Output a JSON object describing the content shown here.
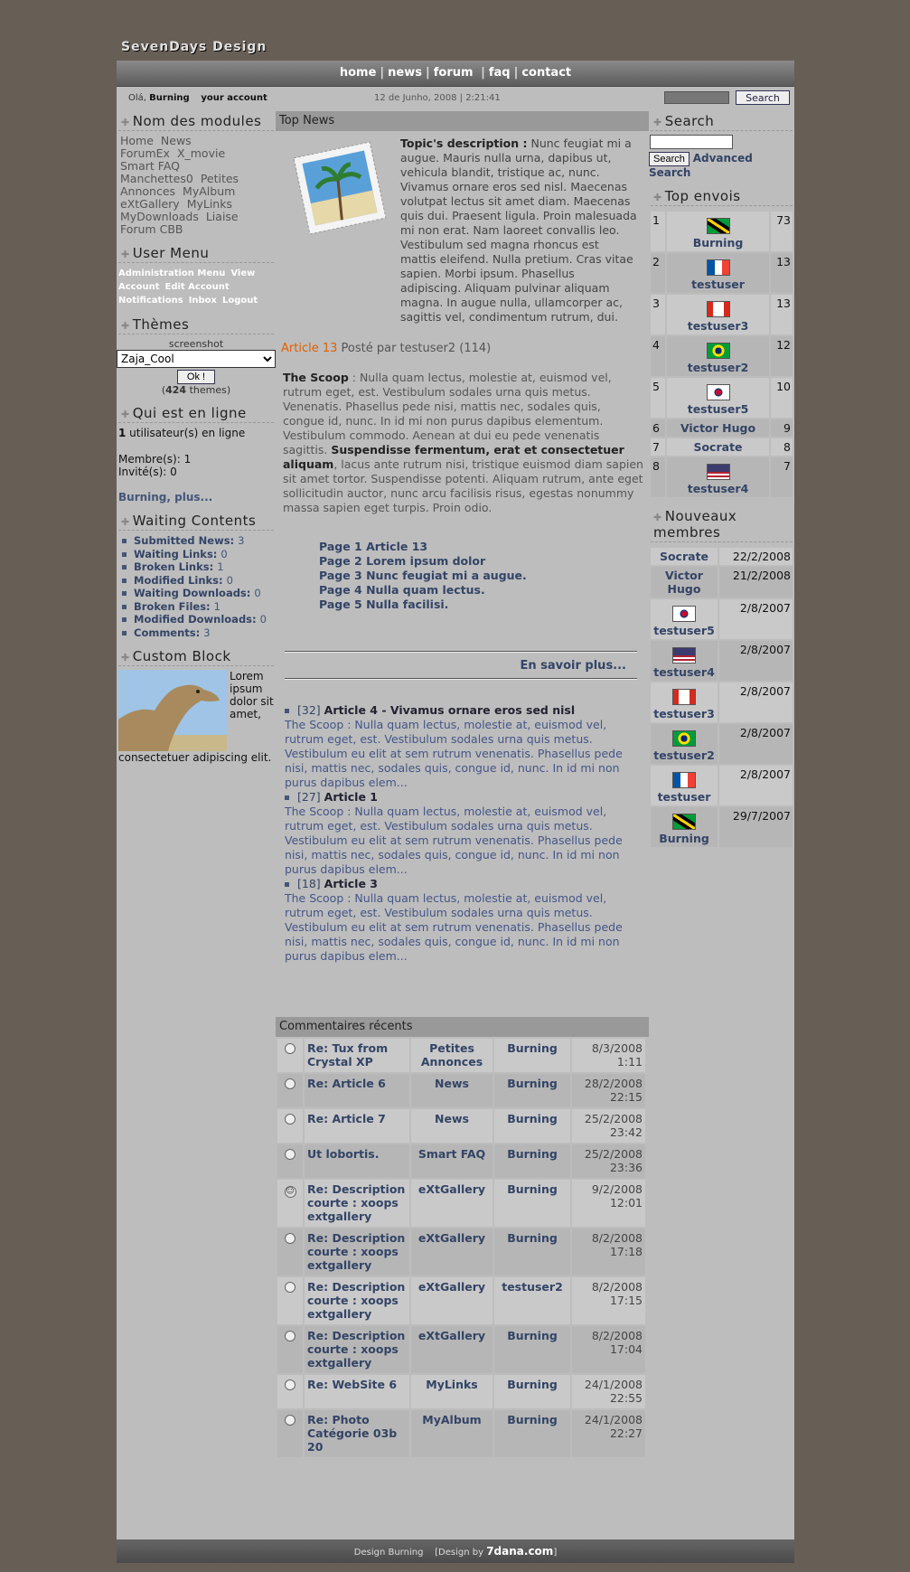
{
  "site": {
    "logo": "SevenDays Design"
  },
  "nav": {
    "items": [
      "home",
      "news",
      "forum",
      "faq",
      "contact"
    ]
  },
  "infobar": {
    "greeting_prefix": "Olá,",
    "username": "Burning",
    "account_link": "your account",
    "datetime": "12 de Junho, 2008 | 2:21:41",
    "search_button": "Search"
  },
  "left": {
    "modules": {
      "title": "Nom des modules",
      "items": [
        "Home",
        "News",
        "ForumEx",
        "X_movie",
        "Smart FAQ",
        "Manchettes0",
        "Petites Annonces",
        "MyAlbum",
        "eXtGallery",
        "MyLinks",
        "MyDownloads",
        "Liaise",
        "Forum CBB"
      ]
    },
    "usermenu": {
      "title": "User Menu",
      "items": [
        "Administration Menu",
        "View Account",
        "Edit Account",
        "Notifications",
        "Inbox",
        "Logout"
      ]
    },
    "themes": {
      "title": "Thèmes",
      "caption": "screenshot",
      "selected": "Zaja_Cool",
      "ok": "Ok !",
      "count_prefix": "(",
      "count": "424",
      "count_suffix": " themes)"
    },
    "online": {
      "title": "Qui est en ligne",
      "count": "1",
      "line1": " utilisateur(s) en ligne",
      "members": "Membre(s): 1",
      "guests": "Invité(s): 0",
      "more": "Burning, plus..."
    },
    "waiting": {
      "title": "Waiting Contents",
      "items": [
        {
          "label": "Submitted News:",
          "value": "3"
        },
        {
          "label": "Waiting Links:",
          "value": "0"
        },
        {
          "label": "Broken Links:",
          "value": "1"
        },
        {
          "label": "Modified Links:",
          "value": "0"
        },
        {
          "label": "Waiting Downloads:",
          "value": "0"
        },
        {
          "label": "Broken Files:",
          "value": "1"
        },
        {
          "label": "Modified Downloads:",
          "value": "0"
        },
        {
          "label": "Comments:",
          "value": "3"
        }
      ]
    },
    "custom": {
      "title": "Custom Block",
      "text": "Lorem ipsum dolor sit amet, consectetuer adipiscing elit."
    }
  },
  "center": {
    "top_news_title": "Top News",
    "desc_label": "Topic's description :",
    "desc_text": " Nunc feugiat mi a augue. Mauris nulla urna, dapibus ut, vehicula blandit, tristique ac, nunc. Vivamus ornare eros sed nisl. Maecenas volutpat lectus sit amet diam. Maecenas quis dui. Praesent ligula. Proin malesuada mi non erat. Nam laoreet convallis leo. Vestibulum sed magna rhoncus est mattis eleifend. Nulla pretium. Cras vitae sapien. Morbi ipsum. Phasellus adipiscing. Aliquam pulvinar aliquam magna. In augue nulla, ullamcorper ac, sagittis vel, condimentum rutrum, dui.",
    "article_title": "Article 13",
    "article_meta": " Posté par testuser2 (114)",
    "scoop_label": "The Scoop",
    "scoop_text1": " : Nulla quam lectus, molestie at, euismod vel, rutrum eget, est. Vestibulum sodales urna quis metus. Venenatis. Phasellus pede nisi, mattis nec, sodales quis, congue id, nunc. In id mi non purus dapibus elementum. Vestibulum commodo. Aenean at dui eu pede venenatis sagittis. ",
    "scoop_bold": "Suspendisse fermentum, erat et consectetuer aliquam",
    "scoop_text2": ", lacus ante rutrum nisi, tristique euismod diam sapien sit amet tortor. Suspendisse potenti. Aliquam rutrum, ante eget sollicitudin auctor, nunc arcu facilisis risus, egestas nonummy massa sapien eget turpis. Proin odio.",
    "pages": [
      "Page 1 Article 13",
      "Page 2 Lorem ipsum dolor",
      "Page 3 Nunc feugiat mi a augue.",
      "Page 4 Nulla quam lectus.",
      "Page 5 Nulla facilisi."
    ],
    "more": "En savoir plus...",
    "related": [
      {
        "id": "[32]",
        "title": "Article 4 - Vivamus ornare eros sed nisl",
        "body": "The Scoop : Nulla quam lectus, molestie at, euismod vel, rutrum eget, est. Vestibulum sodales urna quis metus. Vestibulum eu elit at sem rutrum venenatis. Phasellus pede nisi, mattis nec, sodales quis, congue id, nunc. In id mi non purus dapibus elem..."
      },
      {
        "id": "[27]",
        "title": "Article 1",
        "body": "The Scoop : Nulla quam lectus, molestie at, euismod vel, rutrum eget, est. Vestibulum sodales urna quis metus. Vestibulum eu elit at sem rutrum venenatis. Phasellus pede nisi, mattis nec, sodales quis, congue id, nunc. In id mi non purus dapibus elem..."
      },
      {
        "id": "[18]",
        "title": "Article 3",
        "body": "The Scoop : Nulla quam lectus, molestie at, euismod vel, rutrum eget, est. Vestibulum sodales urna quis metus. Vestibulum eu elit at sem rutrum venenatis. Phasellus pede nisi, mattis nec, sodales quis, congue id, nunc. In id mi non purus dapibus elem..."
      }
    ],
    "comments_title": "Commentaires récents",
    "comments": [
      {
        "icon": "radio",
        "title": "Re: Tux from Crystal XP",
        "module": "Petites Annonces",
        "user": "Burning",
        "date": "8/3/2008 1:11"
      },
      {
        "icon": "radio",
        "title": "Re: Article 6",
        "module": "News",
        "user": "Burning",
        "date": "28/2/2008 22:15"
      },
      {
        "icon": "radio",
        "title": "Re: Article 7",
        "module": "News",
        "user": "Burning",
        "date": "25/2/2008 23:42"
      },
      {
        "icon": "radio",
        "title": "Ut lobortis.",
        "module": "Smart FAQ",
        "user": "Burning",
        "date": "25/2/2008 23:36"
      },
      {
        "icon": "smiley",
        "title": "Re: Description courte : xoops extgallery",
        "module": "eXtGallery",
        "user": "Burning",
        "date": "9/2/2008 12:01"
      },
      {
        "icon": "radio",
        "title": "Re: Description courte : xoops extgallery",
        "module": "eXtGallery",
        "user": "Burning",
        "date": "8/2/2008 17:18"
      },
      {
        "icon": "radio",
        "title": "Re: Description courte : xoops extgallery",
        "module": "eXtGallery",
        "user": "testuser2",
        "date": "8/2/2008 17:15"
      },
      {
        "icon": "radio",
        "title": "Re: Description courte : xoops extgallery",
        "module": "eXtGallery",
        "user": "Burning",
        "date": "8/2/2008 17:04"
      },
      {
        "icon": "radio",
        "title": "Re: WebSite 6",
        "module": "MyLinks",
        "user": "Burning",
        "date": "24/1/2008 22:55"
      },
      {
        "icon": "radio",
        "title": "Re: Photo Catégorie 03b 20",
        "module": "MyAlbum",
        "user": "Burning",
        "date": "24/1/2008 22:27"
      }
    ]
  },
  "right": {
    "search": {
      "title": "Search",
      "button": "Search",
      "advanced": "Advanced Search"
    },
    "top": {
      "title": "Top envois",
      "rows": [
        {
          "rank": "1",
          "flag": "fl-jm",
          "user": "Burning",
          "count": "73"
        },
        {
          "rank": "2",
          "flag": "fl-fr",
          "user": "testuser",
          "count": "13"
        },
        {
          "rank": "3",
          "flag": "fl-ca",
          "user": "testuser3",
          "count": "13"
        },
        {
          "rank": "4",
          "flag": "fl-br",
          "user": "testuser2",
          "count": "12"
        },
        {
          "rank": "5",
          "flag": "fl-kr",
          "user": "testuser5",
          "count": "10"
        },
        {
          "rank": "6",
          "flag": "",
          "user": "Victor Hugo",
          "count": "9"
        },
        {
          "rank": "7",
          "flag": "",
          "user": "Socrate",
          "count": "8"
        },
        {
          "rank": "8",
          "flag": "fl-us",
          "user": "testuser4",
          "count": "7"
        }
      ]
    },
    "newmembers": {
      "title": "Nouveaux membres",
      "rows": [
        {
          "flag": "",
          "user": "Socrate",
          "date": "22/2/2008"
        },
        {
          "flag": "",
          "user": "Victor Hugo",
          "date": "21/2/2008"
        },
        {
          "flag": "fl-kr",
          "user": "testuser5",
          "date": "2/8/2007"
        },
        {
          "flag": "fl-us",
          "user": "testuser4",
          "date": "2/8/2007"
        },
        {
          "flag": "fl-ca",
          "user": "testuser3",
          "date": "2/8/2007"
        },
        {
          "flag": "fl-br",
          "user": "testuser2",
          "date": "2/8/2007"
        },
        {
          "flag": "fl-fr",
          "user": "testuser",
          "date": "2/8/2007"
        },
        {
          "flag": "fl-jm",
          "user": "Burning",
          "date": "29/7/2007"
        }
      ]
    }
  },
  "footer": {
    "text": "Design Burning",
    "design_prefix": "[Design by ",
    "design_link": "7dana.com",
    "design_suffix": "]"
  }
}
